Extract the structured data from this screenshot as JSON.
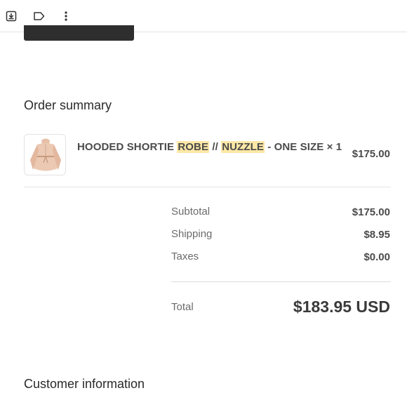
{
  "toolbar": {
    "icons": [
      "download-box-icon",
      "label-tag-icon",
      "more-vertical-icon"
    ]
  },
  "order_summary": {
    "heading": "Order summary",
    "item": {
      "name_part1": "HOODED SHORTIE ",
      "highlight1": "ROBE",
      "name_part2": " // ",
      "highlight2": "NUZZLE",
      "name_part3": " - ONE SIZE × 1",
      "price": "$175.00"
    },
    "subtotal_label": "Subtotal",
    "subtotal_value": "$175.00",
    "shipping_label": "Shipping",
    "shipping_value": "$8.95",
    "taxes_label": "Taxes",
    "taxes_value": "$0.00",
    "total_label": "Total",
    "total_value": "$183.95 USD"
  },
  "customer_information": {
    "heading": "Customer information"
  },
  "colors": {
    "highlight": "#fde8a6",
    "text": "#3a3a3a",
    "muted": "#6b6b6b",
    "divider": "#e4e4e4"
  }
}
